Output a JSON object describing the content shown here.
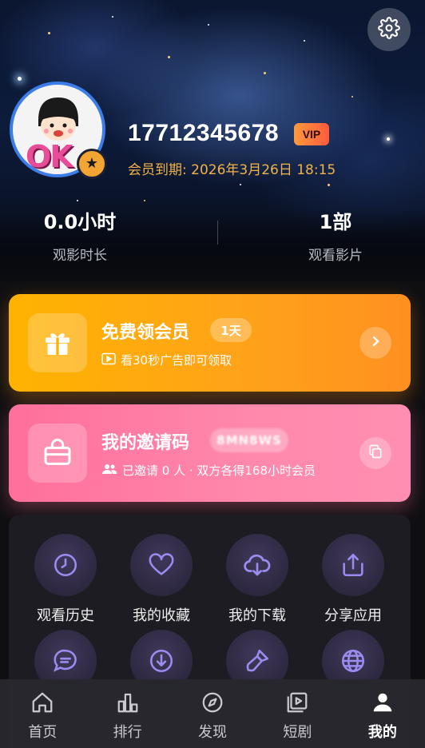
{
  "profile": {
    "phone": "17712345678",
    "vip_label": "VIP",
    "expiry": "会员到期: 2026年3月26日 18:15",
    "avatar_text": "OK"
  },
  "stats": [
    {
      "value": "0.0小时",
      "label": "观影时长"
    },
    {
      "value": "1部",
      "label": "观看影片"
    }
  ],
  "vip_card": {
    "title": "免费领会员",
    "badge": "1天",
    "subtitle": "看30秒广告即可领取"
  },
  "invite_card": {
    "title": "我的邀请码",
    "code": "8MN8WS",
    "subtitle": "已邀请 0 人 · 双方各得168小时会员"
  },
  "grid": [
    {
      "label": "观看历史",
      "icon": "clock-icon"
    },
    {
      "label": "我的收藏",
      "icon": "heart-icon"
    },
    {
      "label": "我的下载",
      "icon": "cloud-download-icon"
    },
    {
      "label": "分享应用",
      "icon": "share-icon"
    },
    {
      "label": "",
      "icon": "message-icon"
    },
    {
      "label": "",
      "icon": "download-circle-icon"
    },
    {
      "label": "",
      "icon": "brush-icon"
    },
    {
      "label": "",
      "icon": "globe-icon"
    }
  ],
  "nav": [
    {
      "label": "首页",
      "icon": "home-icon",
      "active": false
    },
    {
      "label": "排行",
      "icon": "bar-chart-icon",
      "active": false
    },
    {
      "label": "发现",
      "icon": "compass-icon",
      "active": false
    },
    {
      "label": "短剧",
      "icon": "play-video-icon",
      "active": false
    },
    {
      "label": "我的",
      "icon": "user-icon",
      "active": true
    }
  ],
  "colors": {
    "vip_card": "#ffa21a",
    "invite_card": "#ff88ac",
    "accent_text": "#f2b24a",
    "grid_icon": "#9b8cf0"
  }
}
